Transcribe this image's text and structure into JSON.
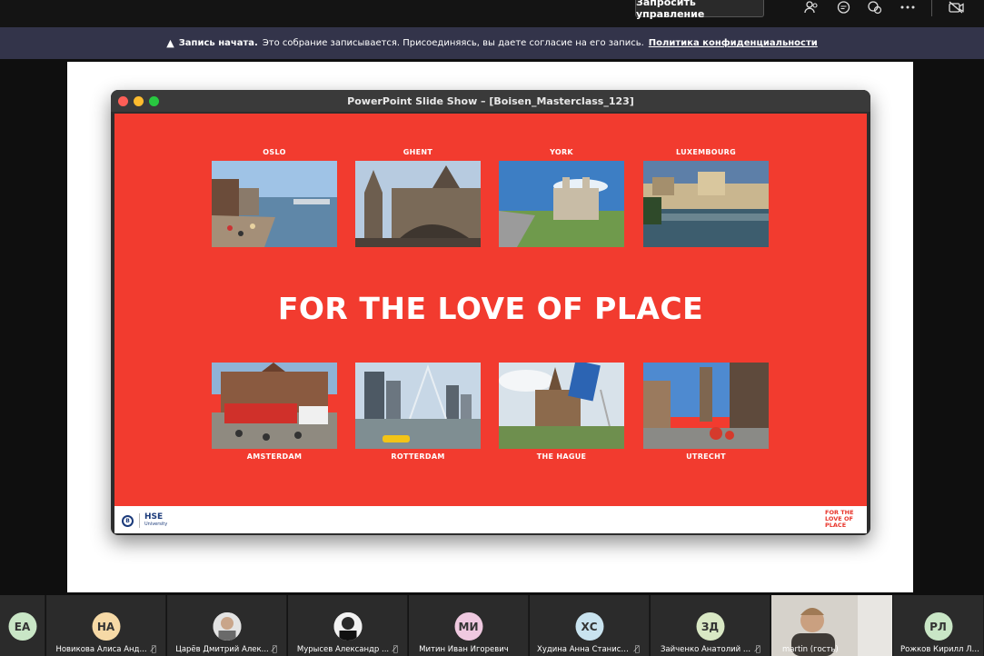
{
  "topbar": {
    "request_control_label": "Запросить управление",
    "icons": [
      "people-icon",
      "chat-icon",
      "reactions-icon",
      "more-icon",
      "camera-off-icon"
    ]
  },
  "banner": {
    "title": "Запись начата.",
    "message": "Это собрание записывается. Присоединяясь, вы даете согласие на его запись.",
    "link": "Политика конфиденциальности"
  },
  "ppt": {
    "window_title": "PowerPoint Slide Show – [Boisen_Masterclass_123]",
    "headline": "FOR THE LOVE OF PLACE",
    "top_cities": [
      "OSLO",
      "GHENT",
      "YORK",
      "LUXEMBOURG"
    ],
    "bottom_cities": [
      "AMSTERDAM",
      "ROTTERDAM",
      "THE HAGUE",
      "UTRECHT"
    ],
    "footer_logo": "HSE",
    "footer_logo_sub": "University",
    "footer_mark": "FOR THE LOVE OF PLACE",
    "slide_color": "#f23b2f"
  },
  "participants": [
    {
      "initials": "ЕА",
      "name": "",
      "color": "#c9e6c6"
    },
    {
      "initials": "НА",
      "name": "Новикова Алиса Анд...",
      "color": "#f6d9a6"
    },
    {
      "initials": "",
      "name": "Царёв Дмитрий Алек...",
      "color": "#d9d9d9"
    },
    {
      "initials": "",
      "name": "Мурысев Александр ...",
      "color": "#f0f0f0"
    },
    {
      "initials": "МИ",
      "name": "Митин Иван Игоревич",
      "color": "#efc9e0"
    },
    {
      "initials": "ХС",
      "name": "Худина Анна Станисл...",
      "color": "#c9e3ef"
    },
    {
      "initials": "ЗД",
      "name": "Зайченко Анатолий ...",
      "color": "#d9e8c4"
    },
    {
      "initials": "",
      "name": "martin (гость)",
      "color": "#d4d0c8"
    },
    {
      "initials": "РЛ",
      "name": "Рожков Кирилл Льво...",
      "color": "#c9e6c6"
    }
  ]
}
